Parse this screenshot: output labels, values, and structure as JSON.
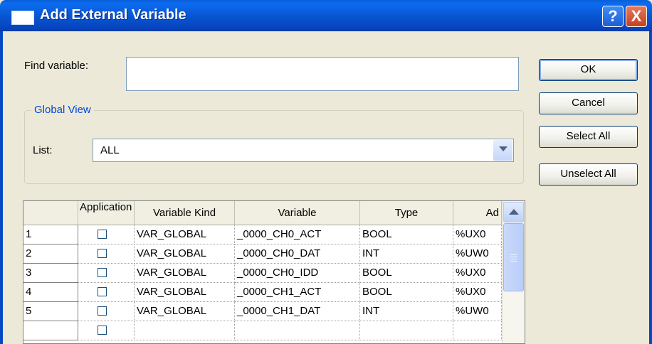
{
  "window": {
    "title": "Add External Variable",
    "help_label": "?",
    "close_label": "X"
  },
  "find": {
    "label": "Find variable:",
    "value": ""
  },
  "buttons": {
    "ok": "OK",
    "cancel": "Cancel",
    "select_all": "Select All",
    "unselect_all": "Unselect All"
  },
  "global_view": {
    "legend": "Global View",
    "list_label": "List:",
    "list_value": "ALL"
  },
  "table": {
    "columns": [
      "",
      "Application",
      "Variable Kind",
      "Variable",
      "Type",
      "Ad"
    ],
    "rows": [
      {
        "num": "1",
        "kind": "VAR_GLOBAL",
        "variable": "_0000_CH0_ACT",
        "type": "BOOL",
        "address": "%UX0"
      },
      {
        "num": "2",
        "kind": "VAR_GLOBAL",
        "variable": "_0000_CH0_DAT",
        "type": "INT",
        "address": "%UW0"
      },
      {
        "num": "3",
        "kind": "VAR_GLOBAL",
        "variable": "_0000_CH0_IDD",
        "type": "BOOL",
        "address": "%UX0"
      },
      {
        "num": "4",
        "kind": "VAR_GLOBAL",
        "variable": "_0000_CH1_ACT",
        "type": "BOOL",
        "address": "%UX0"
      },
      {
        "num": "5",
        "kind": "VAR_GLOBAL",
        "variable": "_0000_CH1_DAT",
        "type": "INT",
        "address": "%UW0"
      }
    ]
  }
}
